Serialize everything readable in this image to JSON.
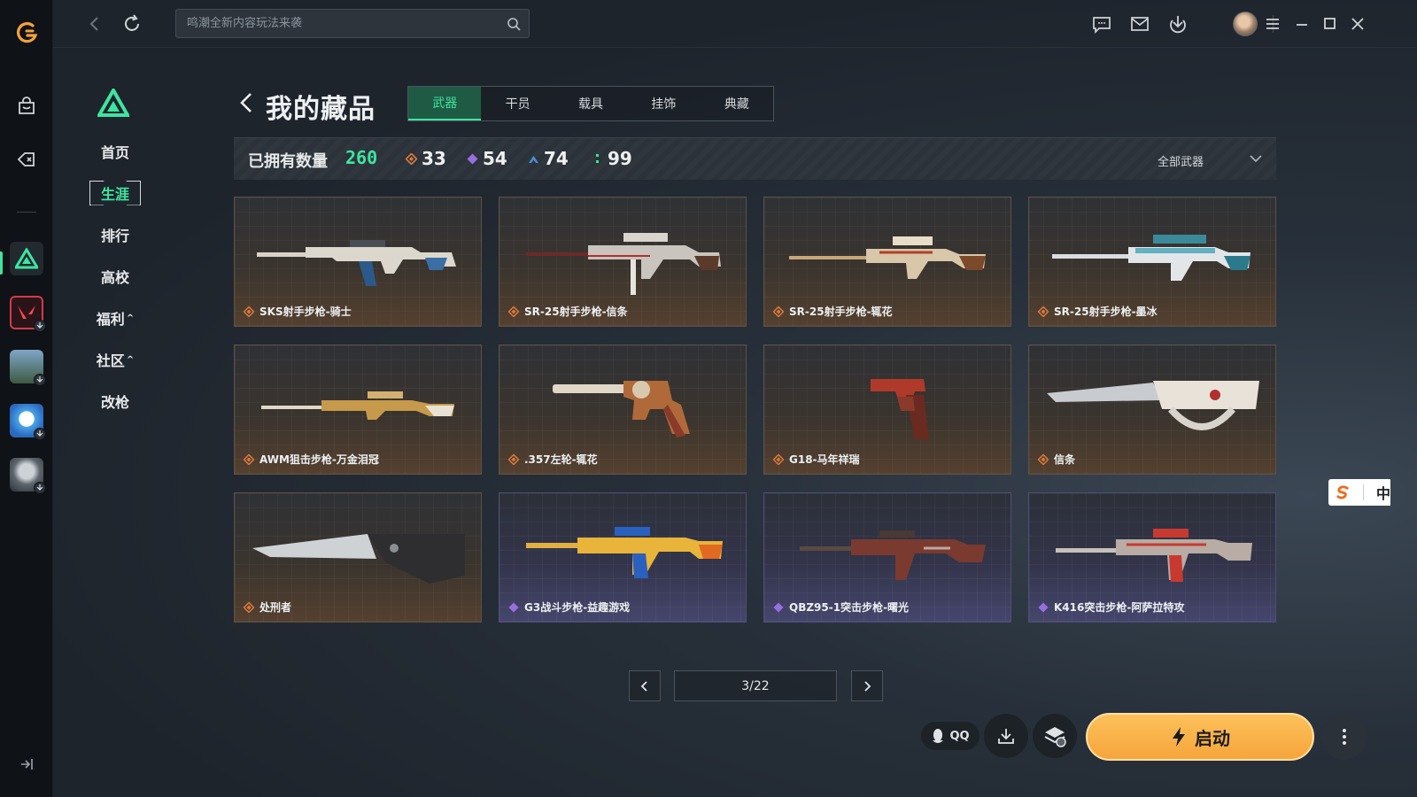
{
  "search": {
    "placeholder": "鸣潮全新内容玩法来袭"
  },
  "sidebar": {
    "items": [
      {
        "label": "首页"
      },
      {
        "label": "生涯"
      },
      {
        "label": "排行"
      },
      {
        "label": "高校"
      },
      {
        "label": "福利",
        "caret": "^"
      },
      {
        "label": "社区",
        "caret": "^"
      },
      {
        "label": "改枪"
      }
    ]
  },
  "header": {
    "title": "我的藏品",
    "tabs": [
      {
        "label": "武器"
      },
      {
        "label": "干员"
      },
      {
        "label": "载具"
      },
      {
        "label": "挂饰"
      },
      {
        "label": "典藏"
      }
    ]
  },
  "stats": {
    "owned_label": "已拥有数量",
    "owned_total": "260",
    "counts": [
      {
        "value": "33",
        "color": "#e07a3a",
        "icon": "orange-diamond-icon"
      },
      {
        "value": "54",
        "color": "#9a6ee0",
        "icon": "purple-diamond-icon"
      },
      {
        "value": "74",
        "color": "#4a8ed8",
        "icon": "blue-chevron-icon"
      },
      {
        "value": "99",
        "color": "#3de5a0",
        "icon": "green-dots-icon"
      }
    ],
    "filter_label": "全部武器"
  },
  "items": [
    {
      "name": "SKS射手步枪-骑士",
      "rarity": "orange"
    },
    {
      "name": "SR-25射手步枪-信条",
      "rarity": "orange"
    },
    {
      "name": "SR-25射手步枪-辄花",
      "rarity": "orange"
    },
    {
      "name": "SR-25射手步枪-墨冰",
      "rarity": "orange"
    },
    {
      "name": "AWM狙击步枪-万金泪冠",
      "rarity": "orange"
    },
    {
      "name": ".357左轮-辄花",
      "rarity": "orange"
    },
    {
      "name": "G18-马年祥瑞",
      "rarity": "orange"
    },
    {
      "name": "信条",
      "rarity": "orange"
    },
    {
      "name": "处刑者",
      "rarity": "orange"
    },
    {
      "name": "G3战斗步枪-益趣游戏",
      "rarity": "purple"
    },
    {
      "name": "QBZ95-1突击步枪-曙光",
      "rarity": "purple"
    },
    {
      "name": "K416突击步枪-阿萨拉特攻",
      "rarity": "purple"
    }
  ],
  "pagination": {
    "current": "3/22"
  },
  "actions": {
    "qq_label": "QQ",
    "launch_label": "启动"
  },
  "ime": {
    "label": "中"
  },
  "colors": {
    "accent": "#3de5a0",
    "launch": "#f8ab3f",
    "orange_rarity": "#e07a3a",
    "purple_rarity": "#9a6ee0"
  }
}
